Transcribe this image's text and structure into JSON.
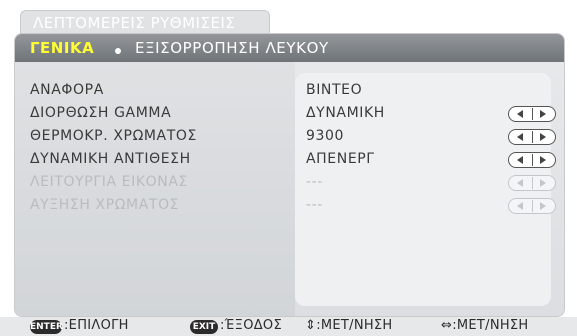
{
  "window": {
    "title": "ΛΕΠΤΟΜΕΡΕΙΣ ΡΥΘΜΙΣΕΙΣ"
  },
  "tabs": [
    {
      "label": "ΓΕΝΙΚΑ",
      "active": true
    },
    {
      "label": "ΕΞΙΣΟΡΡΟΠΗΣΗ ΛΕΥΚΟΥ",
      "active": false
    }
  ],
  "settings": [
    {
      "label": "ΑΝΑΦΟΡΑ",
      "value": "ΒΙΝΤΕΟ",
      "has_arrows": false,
      "enabled": true
    },
    {
      "label": "ΔΙΟΡΘΩΣΗ GAMMA",
      "value": "ΔΥΝΑΜΙΚΗ",
      "has_arrows": true,
      "enabled": true
    },
    {
      "label": "ΘΕΡΜΟΚΡ. ΧΡΩΜΑΤΟΣ",
      "value": "9300",
      "has_arrows": true,
      "enabled": true
    },
    {
      "label": "ΔΥΝΑΜΙΚΗ ΑΝΤΙΘΕΣΗ",
      "value": "ΑΠΕΝΕΡΓ",
      "has_arrows": true,
      "enabled": true
    },
    {
      "label": "ΛΕΙΤΟΥΡΓΙΑ ΕΙΚΟΝΑΣ",
      "value": "---",
      "has_arrows": true,
      "enabled": false
    },
    {
      "label": "ΑΥΞΗΣΗ ΧΡΩΜΑΤΟΣ",
      "value": "---",
      "has_arrows": true,
      "enabled": false
    }
  ],
  "footer": {
    "enter_key": "ENTER",
    "enter_text": ":ΕΠΙΛΟΓΗ",
    "exit_key": "EXIT",
    "exit_text": ":ΈΞΟΔΟΣ",
    "move_vertical_text": "⇕:ΜΕΤ/ΝΗΣΗ",
    "move_horizontal_text": "⇔:ΜΕΤ/ΝΗΣΗ"
  },
  "colors": {
    "active_tab": "#ffff33",
    "header_bg": "#7b8084",
    "text": "#3a3a3a",
    "disabled_text": "#b9bcbf"
  }
}
